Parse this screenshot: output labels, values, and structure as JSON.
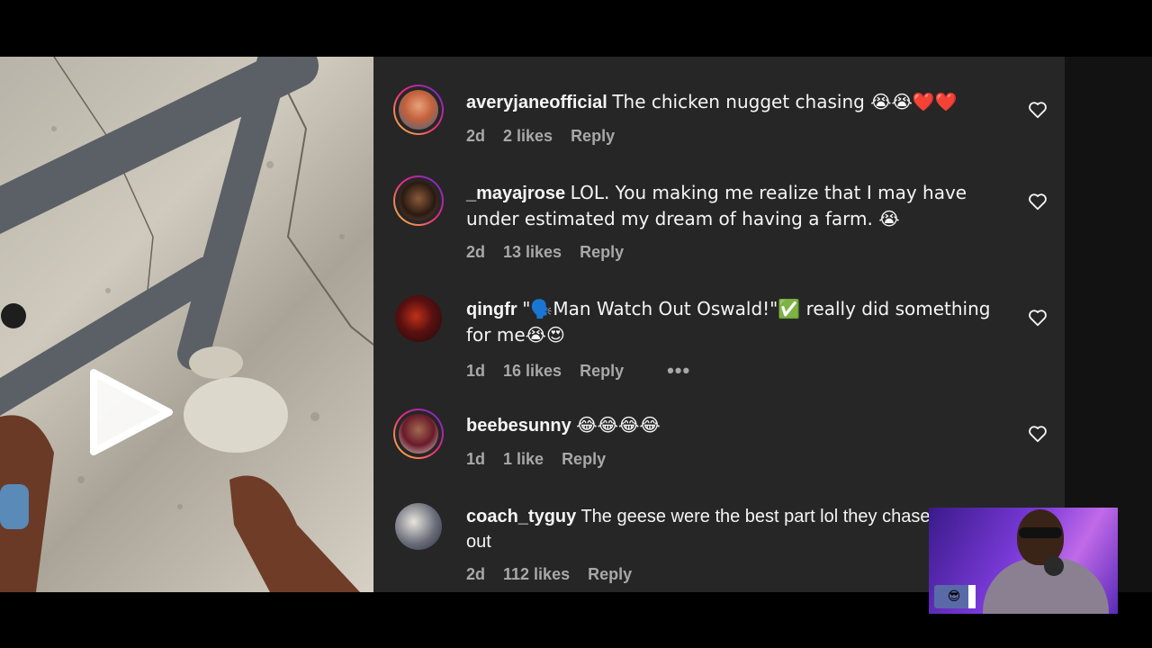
{
  "comments": [
    {
      "username": "averyjaneofficial",
      "text": "The chicken nugget chasing 😭😭❤️❤️",
      "time": "2d",
      "likes": "2 likes",
      "reply": "Reply"
    },
    {
      "username": "_mayajrose",
      "text": "LOL. You making me realize that I may have under estimated my dream of having a farm. 😭",
      "time": "2d",
      "likes": "13 likes",
      "reply": "Reply"
    },
    {
      "username": "qingfr",
      "text": "\"🗣️Man Watch Out Oswald!\"✅ really did something for me😭😍",
      "time": "1d",
      "likes": "16 likes",
      "reply": "Reply",
      "more": "•••"
    },
    {
      "username": "beebesunny",
      "text": "😂😂😂😂",
      "time": "1d",
      "likes": "1 like",
      "reply": "Reply"
    },
    {
      "username": "coach_tyguy",
      "text": "The geese were the best part lol they chased him out",
      "time": "2d",
      "likes": "112 likes",
      "reply": "Reply"
    }
  ],
  "pip": {
    "badge": "😎"
  },
  "colors": {
    "panel": "#262626",
    "text": "#f5f5f5",
    "meta": "#a8a8a8"
  }
}
